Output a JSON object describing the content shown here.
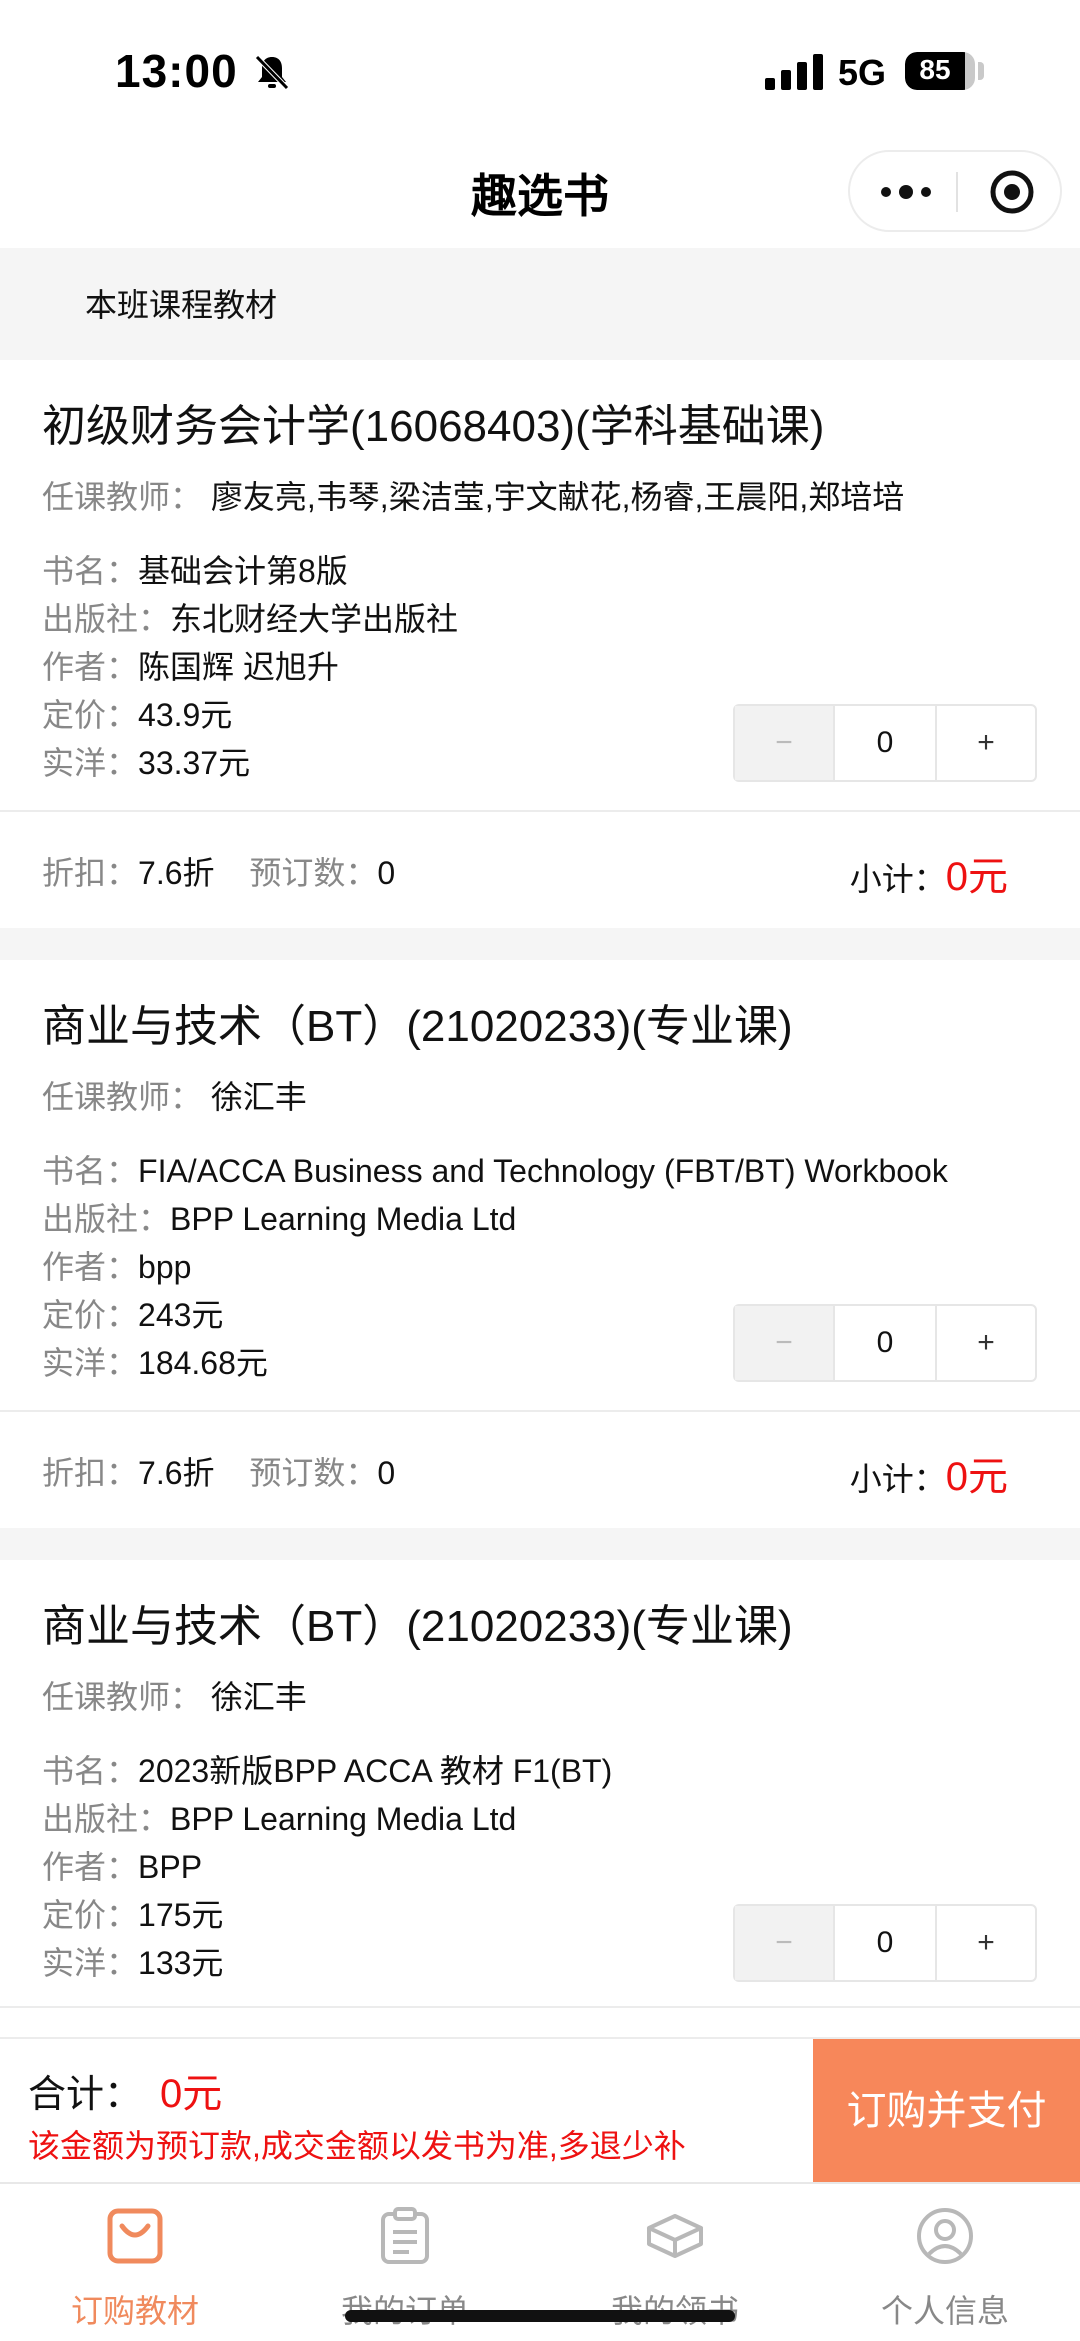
{
  "status_bar": {
    "time": "13:00",
    "network": "5G",
    "battery": "85",
    "battery_level": 0.85
  },
  "header": {
    "title": "趣选书"
  },
  "section": {
    "title": "本班课程教材"
  },
  "labels": {
    "teacher": "任课教师：",
    "book_name": "书名：",
    "publisher": "出版社：",
    "author": "作者：",
    "list_price": "定价：",
    "actual_price": "实洋：",
    "discount": "折扣：",
    "order_count": "预订数：",
    "subtotal": "小计："
  },
  "stepper": {
    "minus": "−",
    "plus": "+"
  },
  "courses": [
    {
      "title": "初级财务会计学(16068403)(学科基础课)",
      "teachers": "廖友亮,韦琴,梁洁莹,宇文献花,杨睿,王晨阳,郑培培",
      "book_name": "基础会计第8版",
      "publisher": "东北财经大学出版社",
      "author": "陈国辉 迟旭升",
      "list_price": "43.9元",
      "actual_price": "33.37元",
      "quantity": "0",
      "discount": "7.6折",
      "order_count": "0",
      "subtotal": "0元"
    },
    {
      "title": "商业与技术（BT）(21020233)(专业课)",
      "teachers": "徐汇丰",
      "book_name": "FIA/ACCA Business and Technology (FBT/BT) Workbook",
      "publisher": "BPP Learning Media Ltd",
      "author": "bpp",
      "list_price": "243元",
      "actual_price": "184.68元",
      "quantity": "0",
      "discount": "7.6折",
      "order_count": "0",
      "subtotal": "0元"
    },
    {
      "title": "商业与技术（BT）(21020233)(专业课)",
      "teachers": "徐汇丰",
      "book_name": "2023新版BPP ACCA 教材 F1(BT)",
      "publisher": "BPP Learning Media Ltd",
      "author": "BPP",
      "list_price": "175元",
      "actual_price": "133元",
      "quantity": "0"
    }
  ],
  "checkout": {
    "total_label": "合计：",
    "total_value": "0元",
    "notice": "该金额为预订款,成交金额以发书为准,多退少补",
    "pay_label": "订购并支付"
  },
  "tabs": [
    {
      "label": "订购教材",
      "icon": "shopping-bag-icon",
      "active": true
    },
    {
      "label": "我的订单",
      "icon": "clipboard-icon",
      "active": false
    },
    {
      "label": "我的领书",
      "icon": "book-stack-icon",
      "active": false
    },
    {
      "label": "个人信息",
      "icon": "user-icon",
      "active": false
    }
  ],
  "colors": {
    "accent": "#f7875a",
    "tab_active": "#f08a5d",
    "price_red": "#ee1111",
    "gray_bg": "#f5f5f5"
  }
}
